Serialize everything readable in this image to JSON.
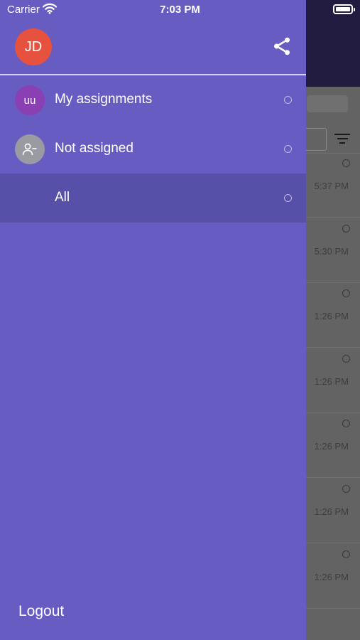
{
  "status_bar": {
    "carrier": "Carrier",
    "time": "7:03 PM"
  },
  "drawer": {
    "user_initials": "JD",
    "menu": [
      {
        "icon_text": "uu",
        "label": "My assignments",
        "icon": "user-initials-avatar",
        "icon_bg": "#8a3fb3"
      },
      {
        "icon_text": "",
        "label": "Not assigned",
        "icon": "person-remove-icon",
        "icon_bg": "#9a9aa3"
      },
      {
        "icon_text": "",
        "label": "All",
        "icon": "",
        "selected": true
      }
    ],
    "logout_label": "Logout"
  },
  "background_list": {
    "times": [
      "5:37 PM",
      "5:30 PM",
      "1:26 PM",
      "1:26 PM",
      "1:26 PM",
      "1:26 PM",
      "1:26 PM"
    ]
  },
  "colors": {
    "drawer_bg": "#665cc2",
    "selected_bg": "#5650a8",
    "avatar_bg": "#e7523f",
    "header_dark": "#211c3f"
  }
}
